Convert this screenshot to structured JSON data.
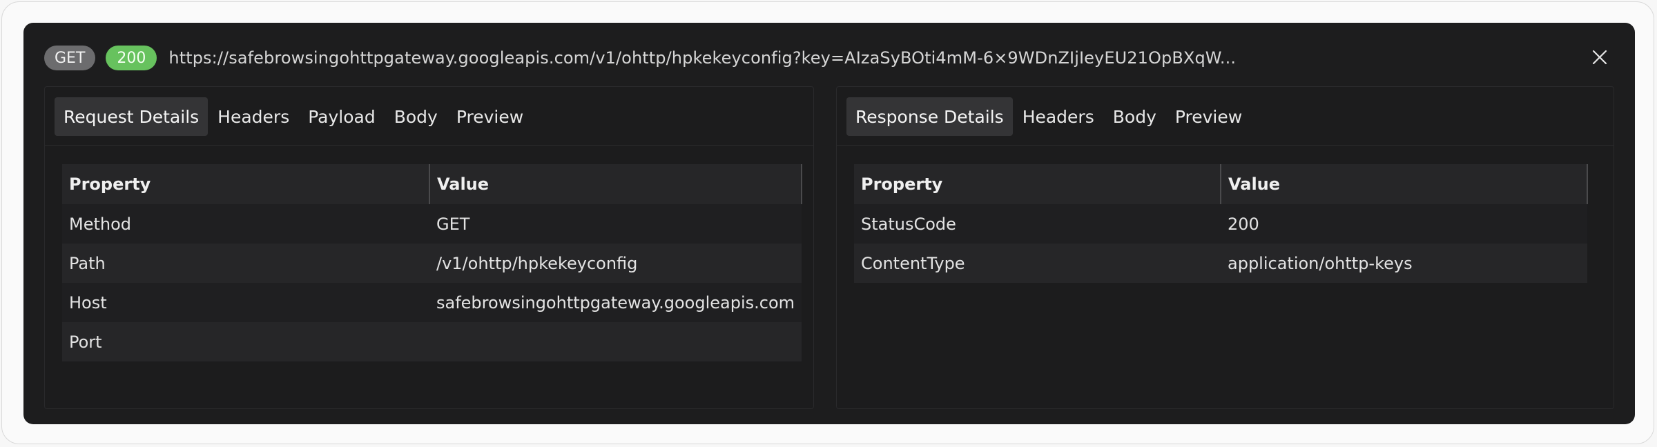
{
  "request_line": {
    "method": "GET",
    "status_code": "200",
    "url": "https://safebrowsingohttpgateway.googleapis.com/v1/ohttp/hpkekeyconfig?key=AIzaSyBOti4mM-6×9WDnZIjIeyEU21OpBXqW..."
  },
  "request_panel": {
    "tabs": [
      {
        "label": "Request Details",
        "active": true
      },
      {
        "label": "Headers",
        "active": false
      },
      {
        "label": "Payload",
        "active": false
      },
      {
        "label": "Body",
        "active": false
      },
      {
        "label": "Preview",
        "active": false
      }
    ],
    "table": {
      "headers": [
        "Property",
        "Value"
      ],
      "rows": [
        {
          "property": "Method",
          "value": "GET"
        },
        {
          "property": "Path",
          "value": "/v1/ohttp/hpkekeyconfig"
        },
        {
          "property": "Host",
          "value": "safebrowsingohttpgateway.googleapis.com"
        },
        {
          "property": "Port",
          "value": ""
        }
      ]
    }
  },
  "response_panel": {
    "tabs": [
      {
        "label": "Response Details",
        "active": true
      },
      {
        "label": "Headers",
        "active": false
      },
      {
        "label": "Body",
        "active": false
      },
      {
        "label": "Preview",
        "active": false
      }
    ],
    "table": {
      "headers": [
        "Property",
        "Value"
      ],
      "rows": [
        {
          "property": "StatusCode",
          "value": "200"
        },
        {
          "property": "ContentType",
          "value": "application/ohttp-keys"
        }
      ]
    }
  },
  "colors": {
    "panel_bg": "#1d1d1e",
    "method_pill": "#6c6c6e",
    "status_pill": "#67c25e",
    "active_tab": "#343436"
  },
  "icons": {
    "close": "close-icon"
  }
}
